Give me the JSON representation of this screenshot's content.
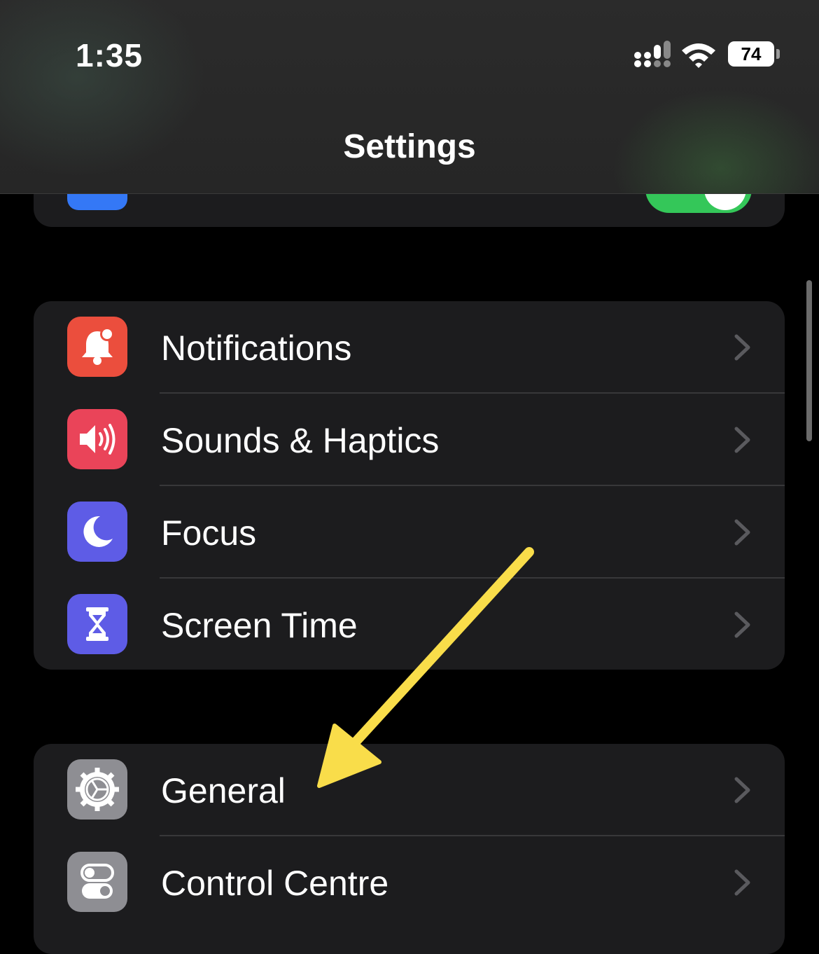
{
  "status_bar": {
    "time": "1:35",
    "battery": "74"
  },
  "header": {
    "title": "Settings"
  },
  "groups": {
    "group1": [
      {
        "label": "Notifications",
        "icon": "bell-icon",
        "color": "#eb4e3d"
      },
      {
        "label": "Sounds & Haptics",
        "icon": "speaker-icon",
        "color": "#ea4459"
      },
      {
        "label": "Focus",
        "icon": "moon-icon",
        "color": "#5e5ce6"
      },
      {
        "label": "Screen Time",
        "icon": "hourglass-icon",
        "color": "#5e5ce6"
      }
    ],
    "group2": [
      {
        "label": "General",
        "icon": "gear-icon",
        "color": "#8e8e93"
      },
      {
        "label": "Control Centre",
        "icon": "toggles-icon",
        "color": "#8e8e93"
      }
    ]
  },
  "annotation": {
    "arrow_color": "#f9dd4a",
    "points_to": "General"
  }
}
